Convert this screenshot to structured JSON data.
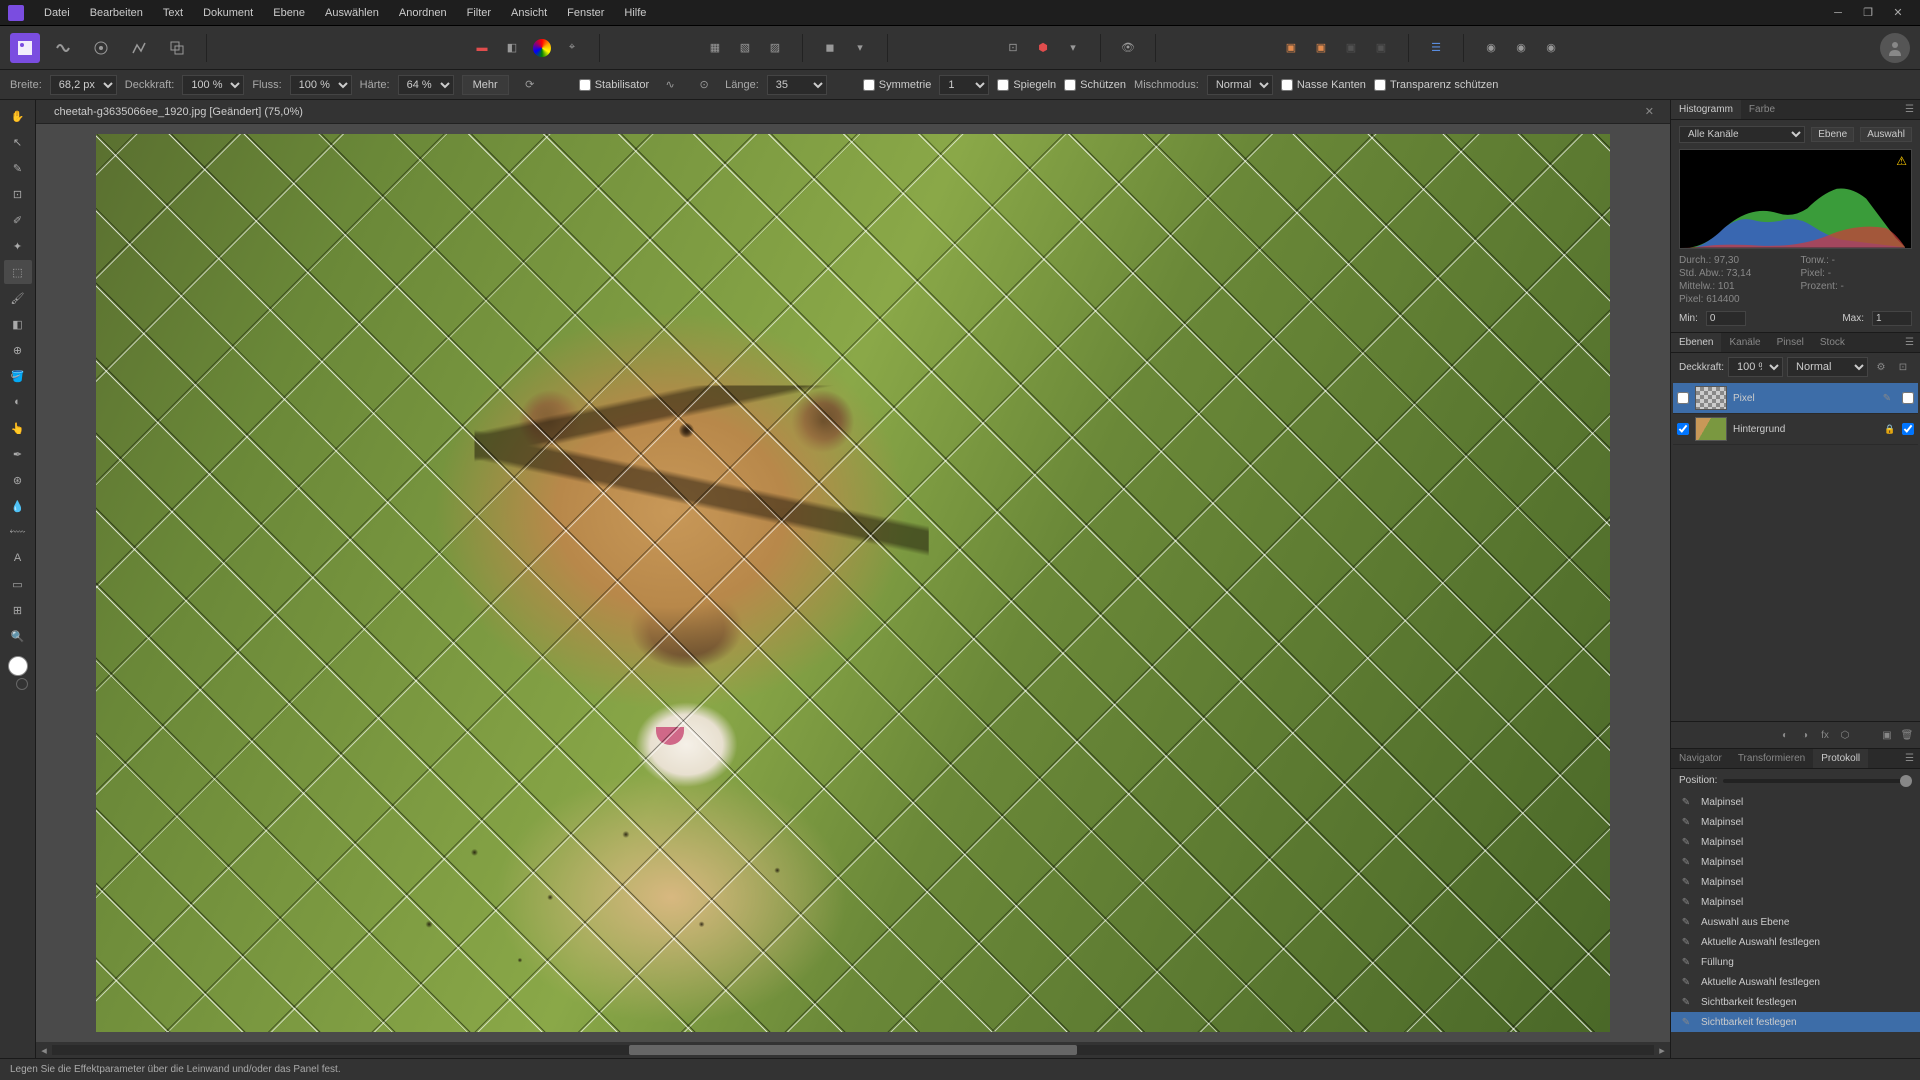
{
  "menu": [
    "Datei",
    "Bearbeiten",
    "Text",
    "Dokument",
    "Ebene",
    "Auswählen",
    "Anordnen",
    "Filter",
    "Ansicht",
    "Fenster",
    "Hilfe"
  ],
  "context": {
    "breite_label": "Breite:",
    "breite": "68,2 px",
    "deckkraft_label": "Deckkraft:",
    "deckkraft": "100 %",
    "fluss_label": "Fluss:",
    "fluss": "100 %",
    "haerte_label": "Härte:",
    "haerte": "64 %",
    "mehr": "Mehr",
    "stabilisator": "Stabilisator",
    "laenge_label": "Länge:",
    "laenge": "35",
    "symmetrie_label": "Symmetrie",
    "symmetrie": "1",
    "spiegeln": "Spiegeln",
    "schuetzen": "Schützen",
    "mischmodus_label": "Mischmodus:",
    "mischmodus": "Normal",
    "nasse_kanten": "Nasse Kanten",
    "transparenz": "Transparenz schützen"
  },
  "doc": {
    "title": "cheetah-g3635066ee_1920.jpg [Geändert] (75,0%)"
  },
  "panels": {
    "histogram_tabs": [
      "Histogramm",
      "Farbe"
    ],
    "hist_channel": "Alle Kanäle",
    "hist_ebene": "Ebene",
    "hist_auswahl": "Auswahl",
    "stats": {
      "durch": "Durch.: 97,30",
      "stdabw": "Std. Abw.: 73,14",
      "mittelw": "Mittelw.: 101",
      "pixel": "Pixel: 614400",
      "tonw": "Tonw.: -",
      "pixel2": "Pixel: -",
      "prozent": "Prozent: -"
    },
    "min_label": "Min:",
    "min": "0",
    "max_label": "Max:",
    "max": "1",
    "layer_tabs": [
      "Ebenen",
      "Kanäle",
      "Pinsel",
      "Stock"
    ],
    "layer_deckkraft_label": "Deckkraft:",
    "layer_deckkraft": "100 %",
    "layer_blend": "Normal",
    "layers": [
      {
        "name": "Pixel",
        "selected": true,
        "thumb": "transparent"
      },
      {
        "name": "Hintergrund",
        "selected": false,
        "thumb": "cheetah",
        "locked": true,
        "vis": true
      }
    ],
    "history_tabs": [
      "Navigator",
      "Transformieren",
      "Protokoll"
    ],
    "position_label": "Position:",
    "history": [
      "Malpinsel",
      "Malpinsel",
      "Malpinsel",
      "Malpinsel",
      "Malpinsel",
      "Malpinsel",
      "Auswahl aus Ebene",
      "Aktuelle Auswahl festlegen",
      "Füllung",
      "Aktuelle Auswahl festlegen",
      "Sichtbarkeit festlegen",
      "Sichtbarkeit festlegen"
    ]
  },
  "statusbar": "Legen Sie die Effektparameter über die Leinwand und/oder das Panel fest."
}
